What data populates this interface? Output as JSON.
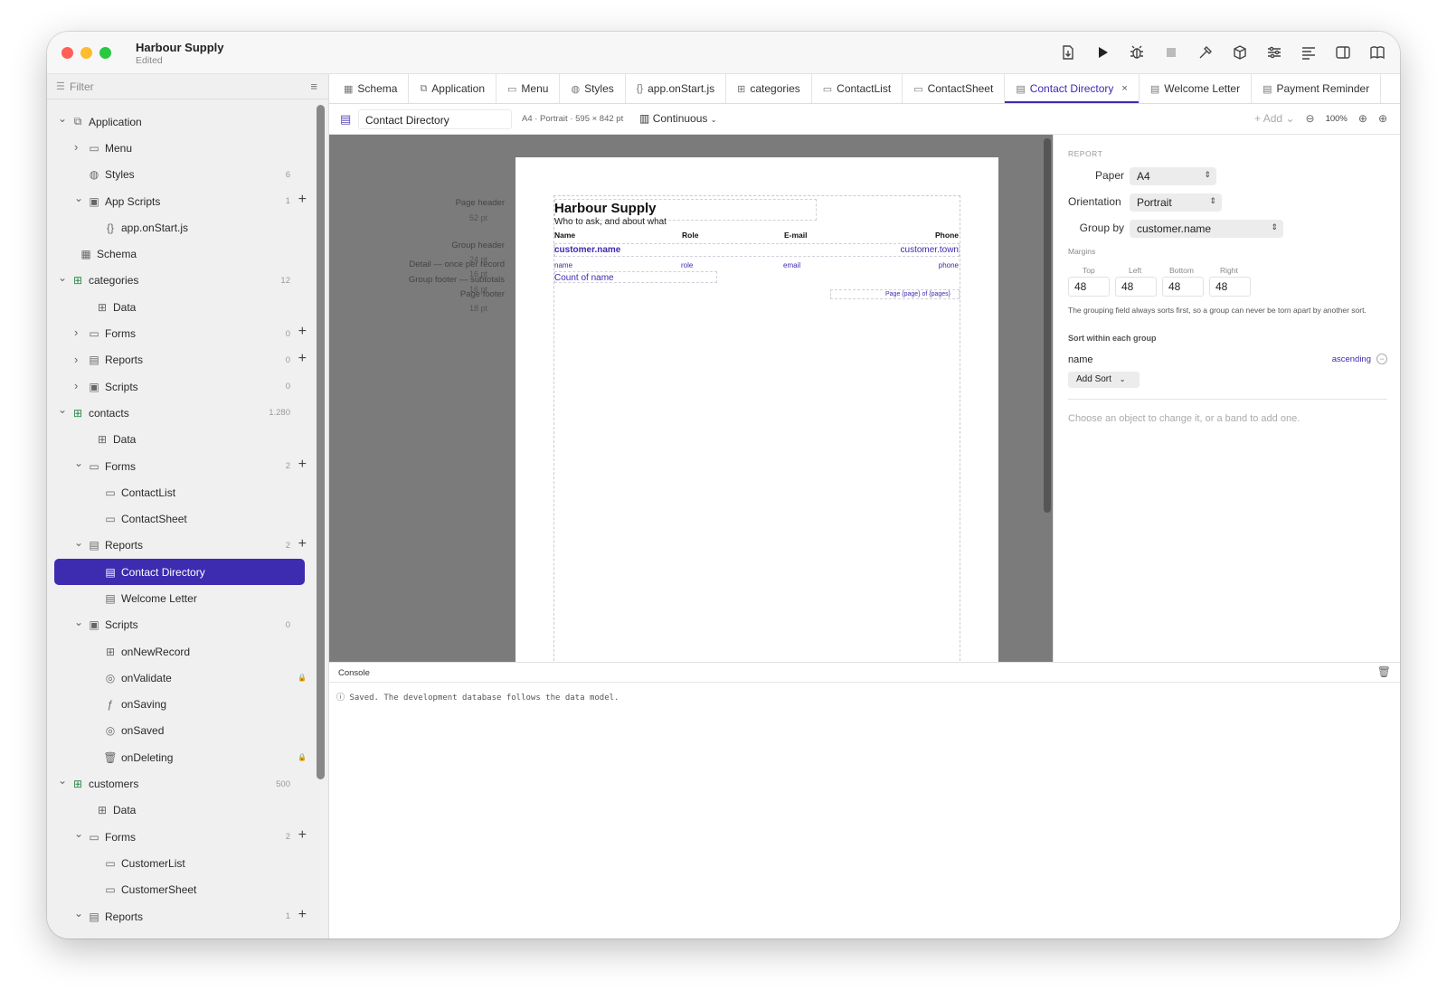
{
  "window": {
    "title": "Harbour Supply",
    "subtitle": "Edited"
  },
  "toolbar": {
    "icons": [
      "export-icon",
      "run-icon",
      "debug-icon",
      "stop-icon",
      "build-icon",
      "package-icon",
      "settings-sliders-icon",
      "align-icon",
      "split-view-icon",
      "book-icon"
    ]
  },
  "sidebar": {
    "filter_placeholder": "Filter",
    "tree": [
      {
        "label": "Application",
        "depth": 0,
        "chev": "down",
        "icon": "app",
        "count": "",
        "plus": false
      },
      {
        "label": "Menu",
        "depth": 1,
        "chev": "right",
        "icon": "menu",
        "count": "",
        "plus": false
      },
      {
        "label": "Styles",
        "depth": 1,
        "chev": "",
        "icon": "palette",
        "count": "6",
        "plus": false
      },
      {
        "label": "App Scripts",
        "depth": 1,
        "chev": "down",
        "icon": "script",
        "count": "1",
        "plus": true
      },
      {
        "label": "app.onStart.js",
        "depth": 2,
        "chev": "",
        "icon": "braces",
        "count": "",
        "plus": false
      },
      {
        "label": "Schema",
        "depth": 0.5,
        "chev": "",
        "icon": "schema",
        "count": "",
        "plus": false
      },
      {
        "label": "categories",
        "depth": 0,
        "chev": "down",
        "icon": "table",
        "count": "12",
        "plus": false
      },
      {
        "label": "Data",
        "depth": 1.5,
        "chev": "",
        "icon": "grid",
        "count": "",
        "plus": false
      },
      {
        "label": "Forms",
        "depth": 1,
        "chev": "right",
        "icon": "form",
        "count": "0",
        "plus": true
      },
      {
        "label": "Reports",
        "depth": 1,
        "chev": "right",
        "icon": "report",
        "count": "0",
        "plus": true
      },
      {
        "label": "Scripts",
        "depth": 1,
        "chev": "right",
        "icon": "script",
        "count": "0",
        "plus": false
      },
      {
        "label": "contacts",
        "depth": 0,
        "chev": "down",
        "icon": "table",
        "count": "1.280",
        "plus": false
      },
      {
        "label": "Data",
        "depth": 1.5,
        "chev": "",
        "icon": "grid",
        "count": "",
        "plus": false
      },
      {
        "label": "Forms",
        "depth": 1,
        "chev": "down",
        "icon": "form",
        "count": "2",
        "plus": true
      },
      {
        "label": "ContactList",
        "depth": 2,
        "chev": "",
        "icon": "form",
        "count": "",
        "plus": false
      },
      {
        "label": "ContactSheet",
        "depth": 2,
        "chev": "",
        "icon": "form",
        "count": "",
        "plus": false
      },
      {
        "label": "Reports",
        "depth": 1,
        "chev": "down",
        "icon": "report",
        "count": "2",
        "plus": true
      },
      {
        "label": "Contact Directory",
        "depth": 2,
        "chev": "",
        "icon": "report",
        "count": "",
        "plus": false,
        "selected": true
      },
      {
        "label": "Welcome Letter",
        "depth": 2,
        "chev": "",
        "icon": "report",
        "count": "",
        "plus": false
      },
      {
        "label": "Scripts",
        "depth": 1,
        "chev": "down",
        "icon": "script",
        "count": "0",
        "plus": false
      },
      {
        "label": "onNewRecord",
        "depth": 2,
        "chev": "",
        "icon": "plus-box",
        "count": "",
        "plus": false
      },
      {
        "label": "onValidate",
        "depth": 2,
        "chev": "",
        "icon": "check-circle",
        "count": "",
        "plus": false,
        "lock": true
      },
      {
        "label": "onSaving",
        "depth": 2,
        "chev": "",
        "icon": "fx",
        "count": "",
        "plus": false
      },
      {
        "label": "onSaved",
        "depth": 2,
        "chev": "",
        "icon": "check-circle",
        "count": "",
        "plus": false
      },
      {
        "label": "onDeleting",
        "depth": 2,
        "chev": "",
        "icon": "trash",
        "count": "",
        "plus": false,
        "lock": true
      },
      {
        "label": "customers",
        "depth": 0,
        "chev": "down",
        "icon": "table",
        "count": "500",
        "plus": false
      },
      {
        "label": "Data",
        "depth": 1.5,
        "chev": "",
        "icon": "grid",
        "count": "",
        "plus": false
      },
      {
        "label": "Forms",
        "depth": 1,
        "chev": "down",
        "icon": "form",
        "count": "2",
        "plus": true
      },
      {
        "label": "CustomerList",
        "depth": 2,
        "chev": "",
        "icon": "form",
        "count": "",
        "plus": false
      },
      {
        "label": "CustomerSheet",
        "depth": 2,
        "chev": "",
        "icon": "form",
        "count": "",
        "plus": false
      },
      {
        "label": "Reports",
        "depth": 1,
        "chev": "down",
        "icon": "report",
        "count": "1",
        "plus": true
      }
    ]
  },
  "tabs": [
    {
      "label": "Schema",
      "icon": "schema"
    },
    {
      "label": "Application",
      "icon": "app"
    },
    {
      "label": "Menu",
      "icon": "menu"
    },
    {
      "label": "Styles",
      "icon": "palette"
    },
    {
      "label": "app.onStart.js",
      "icon": "braces"
    },
    {
      "label": "categories",
      "icon": "table"
    },
    {
      "label": "ContactList",
      "icon": "form"
    },
    {
      "label": "ContactSheet",
      "icon": "form"
    },
    {
      "label": "Contact Directory",
      "icon": "report",
      "active": true
    },
    {
      "label": "Welcome Letter",
      "icon": "report"
    },
    {
      "label": "Payment Reminder",
      "icon": "report"
    }
  ],
  "docbar": {
    "name": "Contact Directory",
    "meta": "A4 · Portrait · 595 × 842 pt",
    "mode": "Continuous",
    "add": "Add",
    "zoom": "100%"
  },
  "report": {
    "bands": {
      "page_header": "Page header",
      "page_header_size": "52 pt",
      "group_header": "Group header",
      "group_header_size": "24 pt",
      "detail": "Detail — once per record",
      "group_footer": "Group footer — subtotals",
      "page_footer": "Page footer",
      "page_footer_size": "18 pt",
      "overlap1": "16 pt",
      "overlap2": "16 pt"
    },
    "title": "Harbour Supply",
    "subtitle": "Who to ask, and about what",
    "headers": [
      "Name",
      "Role",
      "E-mail",
      "Phone"
    ],
    "group_field": "customer.name",
    "group_field_right": "customer.town",
    "detail_fields": [
      "name",
      "role",
      "email",
      "phone"
    ],
    "footer_field": "Count of name",
    "page_number": "Page {page} of {pages}"
  },
  "inspector": {
    "header": "REPORT",
    "paper_label": "Paper",
    "paper_value": "A4",
    "orientation_label": "Orientation",
    "orientation_value": "Portrait",
    "groupby_label": "Group by",
    "groupby_value": "customer.name",
    "margins_label": "Margins",
    "margins": [
      {
        "label": "Top",
        "value": "48"
      },
      {
        "label": "Left",
        "value": "48"
      },
      {
        "label": "Bottom",
        "value": "48"
      },
      {
        "label": "Right",
        "value": "48"
      }
    ],
    "note": "The grouping field always sorts first, so a group can never be torn apart by another sort.",
    "sort_header": "Sort within each group",
    "sort_field": "name",
    "sort_dir": "ascending",
    "add_sort": "Add Sort",
    "hint": "Choose an object to change it, or a band to add one."
  },
  "console": {
    "title": "Console",
    "message": "Saved. The development database follows the data model."
  },
  "colors": {
    "accent": "#3d2bb0",
    "canvas": "#7b7b7b",
    "sidebar": "#f0f0f0"
  }
}
